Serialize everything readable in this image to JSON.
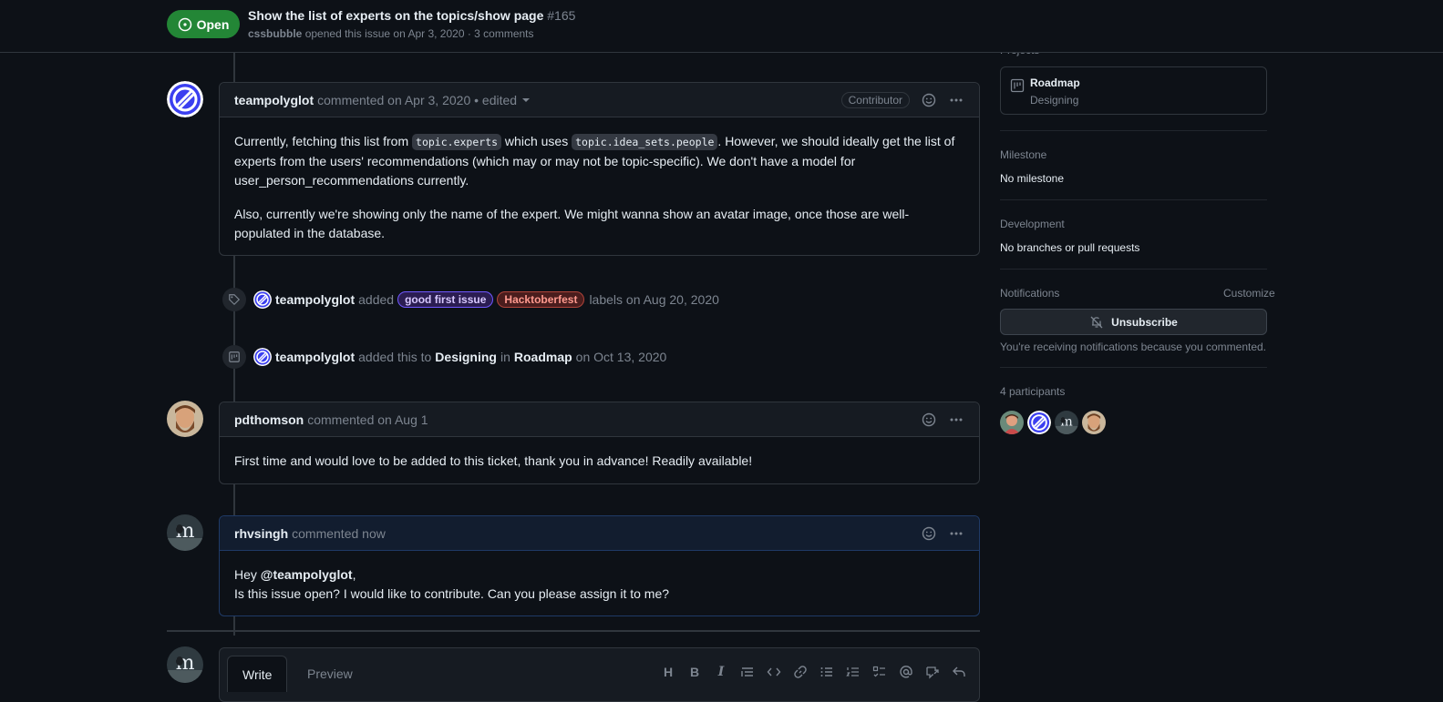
{
  "header": {
    "state": "Open",
    "title": "Show the list of experts on the topics/show page",
    "number": "#165",
    "author": "cssbubble",
    "meta": "opened this issue on Apr 3, 2020 · 3 comments"
  },
  "comments": [
    {
      "author": "teampolyglot",
      "meta": "commented on Apr 3, 2020 • edited",
      "badge": "Contributor",
      "p1_a": "Currently, fetching this list from ",
      "code1": "topic.experts",
      "p1_b": " which uses ",
      "code2": "topic.idea_sets.people",
      "p1_c": ". However, we should ideally get the list of experts from the users' recommendations (which may or may not be topic-specific). We don't have a model for user_person_recommendations currently.",
      "p2": "Also, currently we're showing only the name of the expert. We might wanna show an avatar image, once those are well-populated in the database."
    },
    {
      "author": "pdthomson",
      "meta": "commented on Aug 1",
      "body": "First time and would love to be added to this ticket, thank you in advance! Readily available!"
    },
    {
      "author": "rhvsingh",
      "meta": "commented now",
      "greet": "Hey ",
      "mention": "@teampolyglot",
      "greet_end": ",",
      "body": "Is this issue open? I would like to contribute. Can you please assign it to me?"
    }
  ],
  "events": [
    {
      "actor": "teampolyglot",
      "verb": "added",
      "labels": [
        "good first issue",
        "Hacktoberfest"
      ],
      "tail": "labels on Aug 20, 2020"
    },
    {
      "actor": "teampolyglot",
      "verb": "added this to",
      "column": "Designing",
      "in": "in",
      "project": "Roadmap",
      "tail": "on Oct 13, 2020"
    }
  ],
  "editor": {
    "tab_write": "Write",
    "tab_preview": "Preview",
    "heading_glyph": "H",
    "bold_glyph": "B",
    "italic_glyph": "I"
  },
  "sidebar": {
    "projects_heading": "Projects",
    "project_name": "Roadmap",
    "project_column": "Designing",
    "milestone_heading": "Milestone",
    "milestone_value": "No milestone",
    "development_heading": "Development",
    "development_value": "No branches or pull requests",
    "notifications_heading": "Notifications",
    "customize": "Customize",
    "unsubscribe": "Unsubscribe",
    "notif_reason": "You're receiving notifications because you commented.",
    "participants_heading": "4 participants"
  },
  "colors": {
    "open_green": "#238636",
    "label_good": "#7057ff",
    "label_hacktoberfest": "#b0443a",
    "avatar_polyglot": "#3b3ff0"
  }
}
